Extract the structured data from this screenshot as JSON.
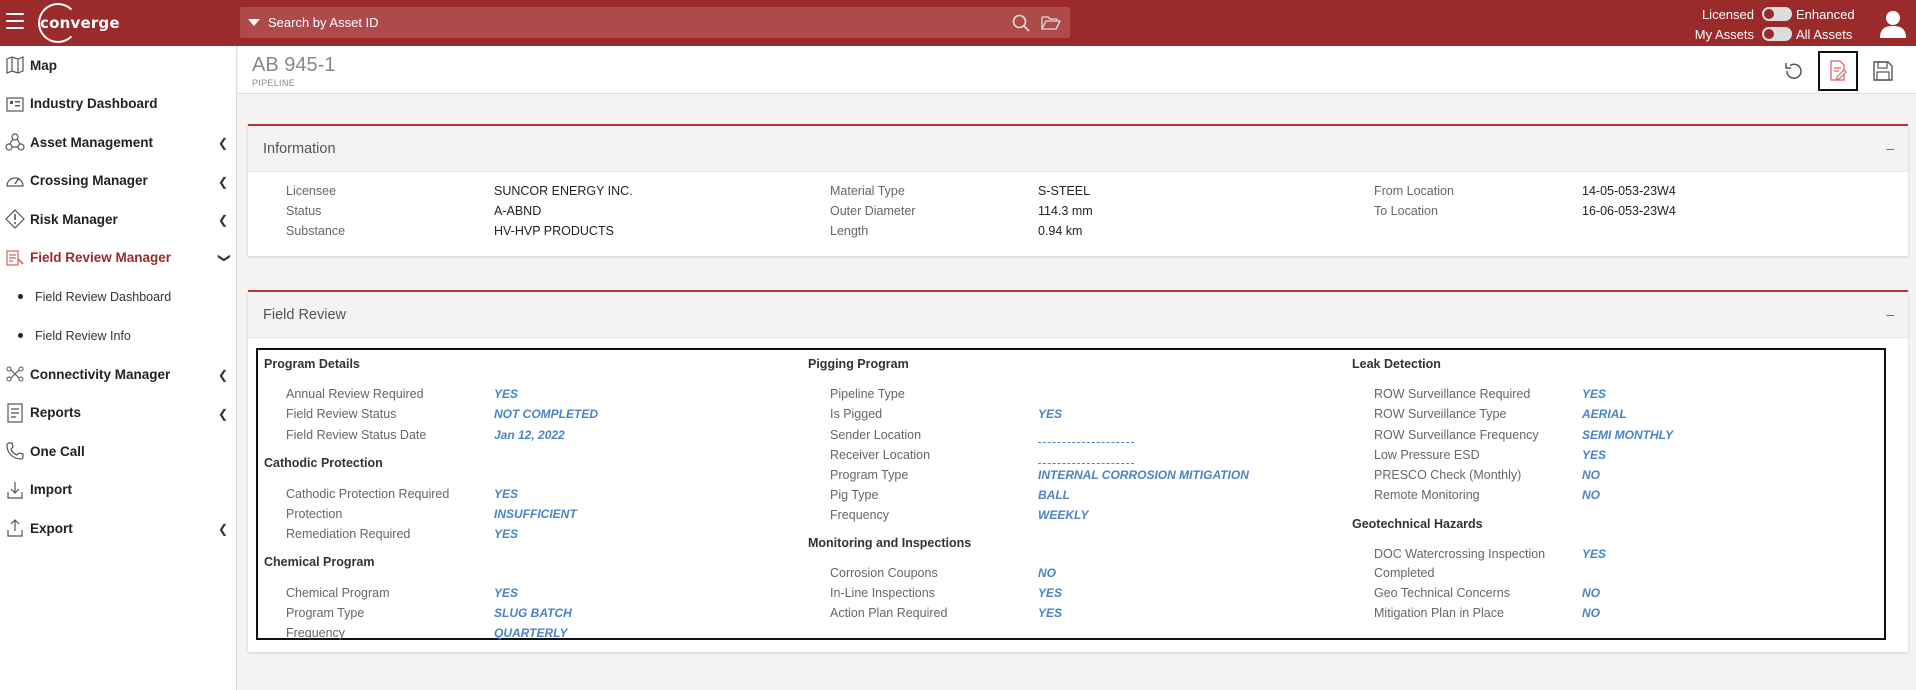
{
  "topbar": {
    "logo_text": "converge",
    "search_placeholder": "Search by Asset ID",
    "toggle_licensed": "Licensed",
    "toggle_enhanced": "Enhanced",
    "toggle_my_assets": "My Assets",
    "toggle_all_assets": "All Assets"
  },
  "sidebar": {
    "items": [
      {
        "label": "Map"
      },
      {
        "label": "Industry Dashboard"
      },
      {
        "label": "Asset Management"
      },
      {
        "label": "Crossing Manager"
      },
      {
        "label": "Risk Manager"
      },
      {
        "label": "Field Review Manager"
      },
      {
        "label": "Connectivity Manager"
      },
      {
        "label": "Reports"
      },
      {
        "label": "One Call"
      },
      {
        "label": "Import"
      },
      {
        "label": "Export"
      }
    ],
    "sub_items": [
      {
        "label": "Field Review Dashboard"
      },
      {
        "label": "Field Review Info"
      }
    ]
  },
  "header": {
    "asset_id": "AB 945-1",
    "asset_type": "PIPELINE"
  },
  "information": {
    "title": "Information",
    "collapse": "–",
    "col1": [
      {
        "label": "Licensee",
        "value": "SUNCOR ENERGY INC."
      },
      {
        "label": "Status",
        "value": "A-ABND"
      },
      {
        "label": "Substance",
        "value": "HV-HVP PRODUCTS"
      }
    ],
    "col2": [
      {
        "label": "Material Type",
        "value": "S-STEEL"
      },
      {
        "label": "Outer Diameter",
        "value": "114.3 mm"
      },
      {
        "label": "Length",
        "value": "0.94 km"
      }
    ],
    "col3": [
      {
        "label": "From Location",
        "value": "14-05-053-23W4"
      },
      {
        "label": "To Location",
        "value": "16-06-053-23W4"
      }
    ]
  },
  "field_review": {
    "title": "Field Review",
    "collapse": "–",
    "program_details": {
      "title": "Program Details",
      "rows": [
        {
          "label": "Annual Review Required",
          "value": "YES"
        },
        {
          "label": "Field Review Status",
          "value": "NOT COMPLETED"
        },
        {
          "label": "Field Review Status Date",
          "value": "Jan 12, 2022"
        }
      ]
    },
    "cathodic": {
      "title": "Cathodic Protection",
      "rows": [
        {
          "label": "Cathodic Protection Required",
          "value": "YES"
        },
        {
          "label": "Protection",
          "value": "INSUFFICIENT"
        },
        {
          "label": "Remediation Required",
          "value": "YES"
        }
      ]
    },
    "chemical": {
      "title": "Chemical Program",
      "rows": [
        {
          "label": "Chemical Program",
          "value": "YES"
        },
        {
          "label": "Program Type",
          "value": "SLUG BATCH"
        },
        {
          "label": "Frequency",
          "value": "QUARTERLY"
        }
      ]
    },
    "pigging": {
      "title": "Pigging Program",
      "rows": [
        {
          "label": "Pipeline Type",
          "value": ""
        },
        {
          "label": "Is Pigged",
          "value": "YES"
        },
        {
          "label": "Sender Location",
          "value": ""
        },
        {
          "label": "Receiver Location",
          "value": ""
        },
        {
          "label": "Program Type",
          "value": "INTERNAL CORROSION MITIGATION"
        },
        {
          "label": "Pig Type",
          "value": "BALL"
        },
        {
          "label": "Frequency",
          "value": "WEEKLY"
        }
      ]
    },
    "monitoring": {
      "title": "Monitoring and Inspections",
      "rows": [
        {
          "label": "Corrosion Coupons",
          "value": "NO"
        },
        {
          "label": "In-Line Inspections",
          "value": "YES"
        },
        {
          "label": "Action Plan Required",
          "value": "YES"
        }
      ]
    },
    "leak": {
      "title": "Leak Detection",
      "rows": [
        {
          "label": "ROW Surveillance Required",
          "value": "YES"
        },
        {
          "label": "ROW Surveillance Type",
          "value": "AERIAL"
        },
        {
          "label": "ROW Surveillance Frequency",
          "value": "SEMI MONTHLY"
        },
        {
          "label": "Low Pressure ESD",
          "value": "YES"
        },
        {
          "label": "PRESCO Check (Monthly)",
          "value": "NO"
        },
        {
          "label": "Remote Monitoring",
          "value": "NO"
        }
      ]
    },
    "geotech": {
      "title": "Geotechnical Hazards",
      "rows": [
        {
          "label": "DOC Watercrossing Inspection",
          "label2": "Completed",
          "value": "YES"
        },
        {
          "label": "Geo Technical Concerns",
          "value": "NO"
        },
        {
          "label": "Mitigation Plan in Place",
          "value": "NO"
        }
      ]
    }
  },
  "colors": {
    "brand": "#9b2a2a",
    "value_blue": "#4a84c4",
    "active_nav": "#9b2a2a"
  }
}
